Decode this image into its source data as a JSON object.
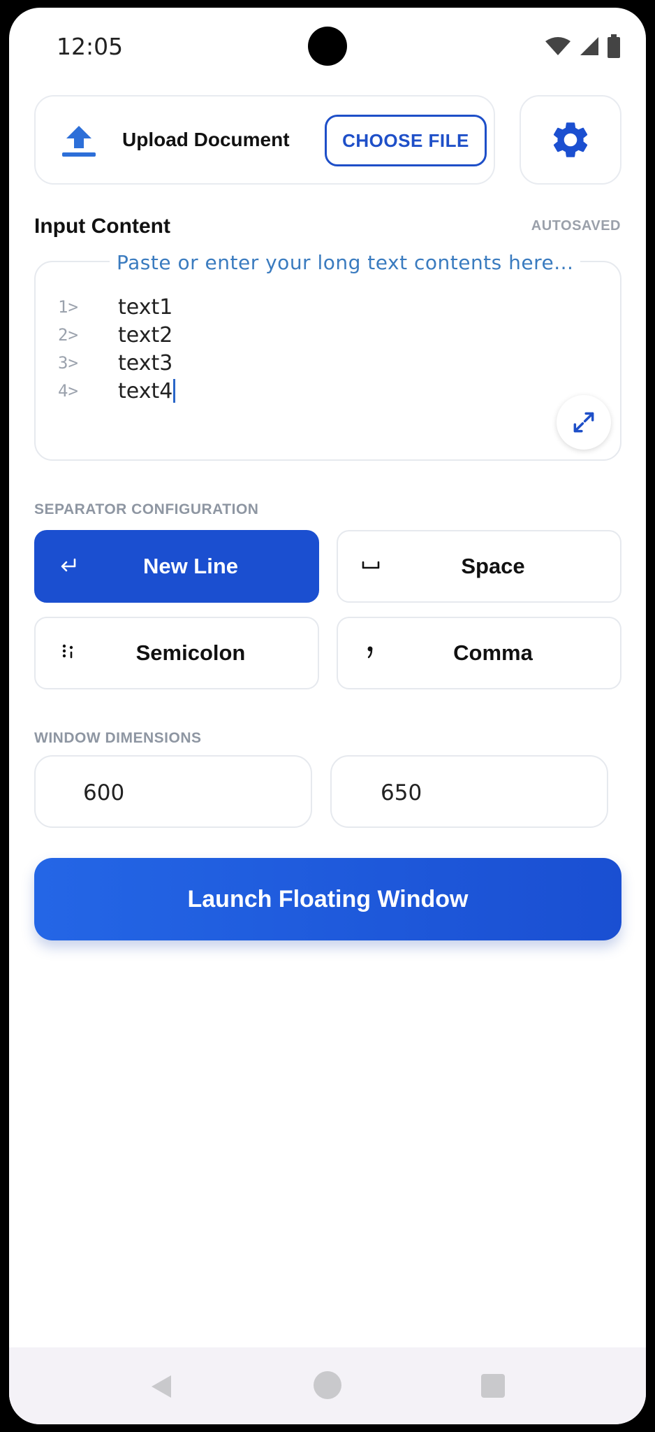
{
  "status_bar": {
    "time": "12:05"
  },
  "upload": {
    "label": "Upload Document",
    "choose_file_label": "CHOOSE FILE",
    "upload_icon": "upload-icon",
    "settings_icon": "gear-icon"
  },
  "input": {
    "title": "Input Content",
    "status": "AUTOSAVED",
    "placeholder": "Paste or enter your long text contents here...",
    "lines": [
      {
        "num": "1>",
        "text": "text1"
      },
      {
        "num": "2>",
        "text": "text2"
      },
      {
        "num": "3>",
        "text": "text3"
      },
      {
        "num": "4>",
        "text": "text4"
      }
    ],
    "expand_icon": "expand-icon"
  },
  "separator": {
    "title": "SEPARATOR CONFIGURATION",
    "options": [
      {
        "label": "New Line",
        "icon": "return-icon",
        "selected": true
      },
      {
        "label": "Space",
        "icon": "space-icon",
        "selected": false
      },
      {
        "label": "Semicolon",
        "icon": "semicolon-icon",
        "selected": false
      },
      {
        "label": "Comma",
        "icon": "comma-icon",
        "selected": false
      }
    ]
  },
  "dimensions": {
    "title": "WINDOW DIMENSIONS",
    "width": "600",
    "height": "650"
  },
  "launch": {
    "label": "Launch Floating Window"
  },
  "colors": {
    "accent": "#1b4fd0",
    "placeholder": "#3a7bbf",
    "muted": "#8e96a2"
  }
}
